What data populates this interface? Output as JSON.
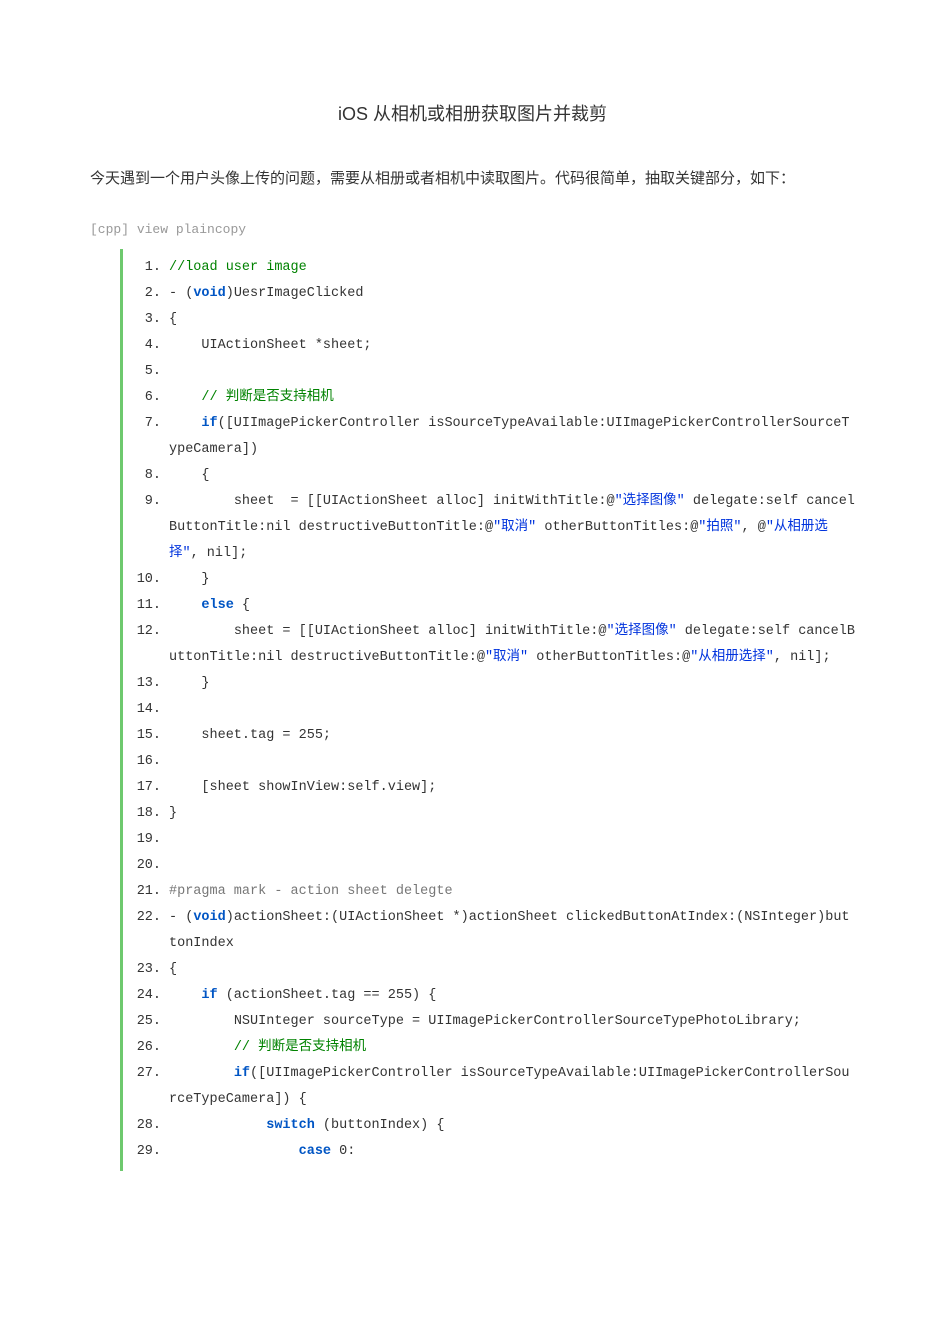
{
  "title": "iOS  从相机或相册获取图片并裁剪",
  "intro": "今天遇到一个用户头像上传的问题，需要从相册或者相机中读取图片。代码很简单，抽取关键部分，如下：",
  "meta": {
    "lang": "[cpp]",
    "links": "view plaincopy"
  },
  "code": {
    "lines": [
      {
        "n": "1.",
        "segs": [
          {
            "cls": "c-comment",
            "t": "//load user image"
          }
        ]
      },
      {
        "n": "2.",
        "segs": [
          {
            "cls": "c-normal",
            "t": "- ("
          },
          {
            "cls": "c-keyword",
            "t": "void"
          },
          {
            "cls": "c-normal",
            "t": ")UesrImageClicked"
          }
        ]
      },
      {
        "n": "3.",
        "segs": [
          {
            "cls": "c-normal",
            "t": "{"
          }
        ]
      },
      {
        "n": "4.",
        "segs": [
          {
            "cls": "c-normal",
            "t": "    UIActionSheet *sheet;"
          }
        ]
      },
      {
        "n": "5.",
        "segs": [
          {
            "cls": "c-normal",
            "t": ""
          }
        ]
      },
      {
        "n": "6.",
        "segs": [
          {
            "cls": "c-normal",
            "t": "    "
          },
          {
            "cls": "c-comment",
            "t": "// 判断是否支持相机"
          }
        ]
      },
      {
        "n": "7.",
        "segs": [
          {
            "cls": "c-normal",
            "t": "    "
          },
          {
            "cls": "c-keyword",
            "t": "if"
          },
          {
            "cls": "c-normal",
            "t": "([UIImagePickerController isSourceTypeAvailable:UIImagePickerControllerSourceTypeCamera])"
          }
        ]
      },
      {
        "n": "8.",
        "segs": [
          {
            "cls": "c-normal",
            "t": "    {"
          }
        ]
      },
      {
        "n": "9.",
        "segs": [
          {
            "cls": "c-normal",
            "t": "        sheet  = [[UIActionSheet alloc] initWithTitle:@"
          },
          {
            "cls": "c-string",
            "t": "\"选择图像\""
          },
          {
            "cls": "c-normal",
            "t": " delegate:self cancelButtonTitle:nil destructiveButtonTitle:@"
          },
          {
            "cls": "c-string",
            "t": "\"取消\""
          },
          {
            "cls": "c-normal",
            "t": " otherButtonTitles:@"
          },
          {
            "cls": "c-string",
            "t": "\"拍照\""
          },
          {
            "cls": "c-normal",
            "t": ", @"
          },
          {
            "cls": "c-string",
            "t": "\"从相册选择\""
          },
          {
            "cls": "c-normal",
            "t": ", nil];"
          }
        ]
      },
      {
        "n": "10.",
        "segs": [
          {
            "cls": "c-normal",
            "t": "    }"
          }
        ]
      },
      {
        "n": "11.",
        "segs": [
          {
            "cls": "c-normal",
            "t": "    "
          },
          {
            "cls": "c-keyword",
            "t": "else"
          },
          {
            "cls": "c-normal",
            "t": " {"
          }
        ]
      },
      {
        "n": "12.",
        "segs": [
          {
            "cls": "c-normal",
            "t": "        sheet = [[UIActionSheet alloc] initWithTitle:@"
          },
          {
            "cls": "c-string",
            "t": "\"选择图像\""
          },
          {
            "cls": "c-normal",
            "t": " delegate:self cancelButtonTitle:nil destructiveButtonTitle:@"
          },
          {
            "cls": "c-string",
            "t": "\"取消\""
          },
          {
            "cls": "c-normal",
            "t": " otherButtonTitles:@"
          },
          {
            "cls": "c-string",
            "t": "\"从相册选择\""
          },
          {
            "cls": "c-normal",
            "t": ", nil];"
          }
        ]
      },
      {
        "n": "13.",
        "segs": [
          {
            "cls": "c-normal",
            "t": "    }"
          }
        ]
      },
      {
        "n": "14.",
        "segs": [
          {
            "cls": "c-normal",
            "t": ""
          }
        ]
      },
      {
        "n": "15.",
        "segs": [
          {
            "cls": "c-normal",
            "t": "    sheet.tag = 255;"
          }
        ]
      },
      {
        "n": "16.",
        "segs": [
          {
            "cls": "c-normal",
            "t": ""
          }
        ]
      },
      {
        "n": "17.",
        "segs": [
          {
            "cls": "c-normal",
            "t": "    [sheet showInView:self.view];"
          }
        ]
      },
      {
        "n": "18.",
        "segs": [
          {
            "cls": "c-normal",
            "t": "}"
          }
        ]
      },
      {
        "n": "19.",
        "segs": [
          {
            "cls": "c-normal",
            "t": ""
          }
        ]
      },
      {
        "n": "20.",
        "segs": [
          {
            "cls": "c-normal",
            "t": ""
          }
        ]
      },
      {
        "n": "21.",
        "segs": [
          {
            "cls": "c-preproc",
            "t": "#pragma mark - action sheet delegte"
          }
        ]
      },
      {
        "n": "22.",
        "segs": [
          {
            "cls": "c-normal",
            "t": "- ("
          },
          {
            "cls": "c-keyword",
            "t": "void"
          },
          {
            "cls": "c-normal",
            "t": ")actionSheet:(UIActionSheet *)actionSheet clickedButtonAtIndex:(NSInteger)buttonIndex"
          }
        ]
      },
      {
        "n": "23.",
        "segs": [
          {
            "cls": "c-normal",
            "t": "{"
          }
        ]
      },
      {
        "n": "24.",
        "segs": [
          {
            "cls": "c-normal",
            "t": "    "
          },
          {
            "cls": "c-keyword",
            "t": "if"
          },
          {
            "cls": "c-normal",
            "t": " (actionSheet.tag == 255) {"
          }
        ]
      },
      {
        "n": "25.",
        "segs": [
          {
            "cls": "c-normal",
            "t": "        NSUInteger sourceType = UIImagePickerControllerSourceTypePhotoLibrary;"
          }
        ]
      },
      {
        "n": "26.",
        "segs": [
          {
            "cls": "c-normal",
            "t": "        "
          },
          {
            "cls": "c-comment",
            "t": "// 判断是否支持相机"
          }
        ]
      },
      {
        "n": "27.",
        "segs": [
          {
            "cls": "c-normal",
            "t": "        "
          },
          {
            "cls": "c-keyword",
            "t": "if"
          },
          {
            "cls": "c-normal",
            "t": "([UIImagePickerController isSourceTypeAvailable:UIImagePickerControllerSourceTypeCamera]) {"
          }
        ]
      },
      {
        "n": "28.",
        "segs": [
          {
            "cls": "c-normal",
            "t": "            "
          },
          {
            "cls": "c-keyword",
            "t": "switch"
          },
          {
            "cls": "c-normal",
            "t": " (buttonIndex) {"
          }
        ]
      },
      {
        "n": "29.",
        "segs": [
          {
            "cls": "c-normal",
            "t": "                "
          },
          {
            "cls": "c-keyword",
            "t": "case"
          },
          {
            "cls": "c-normal",
            "t": " 0:"
          }
        ]
      }
    ]
  }
}
